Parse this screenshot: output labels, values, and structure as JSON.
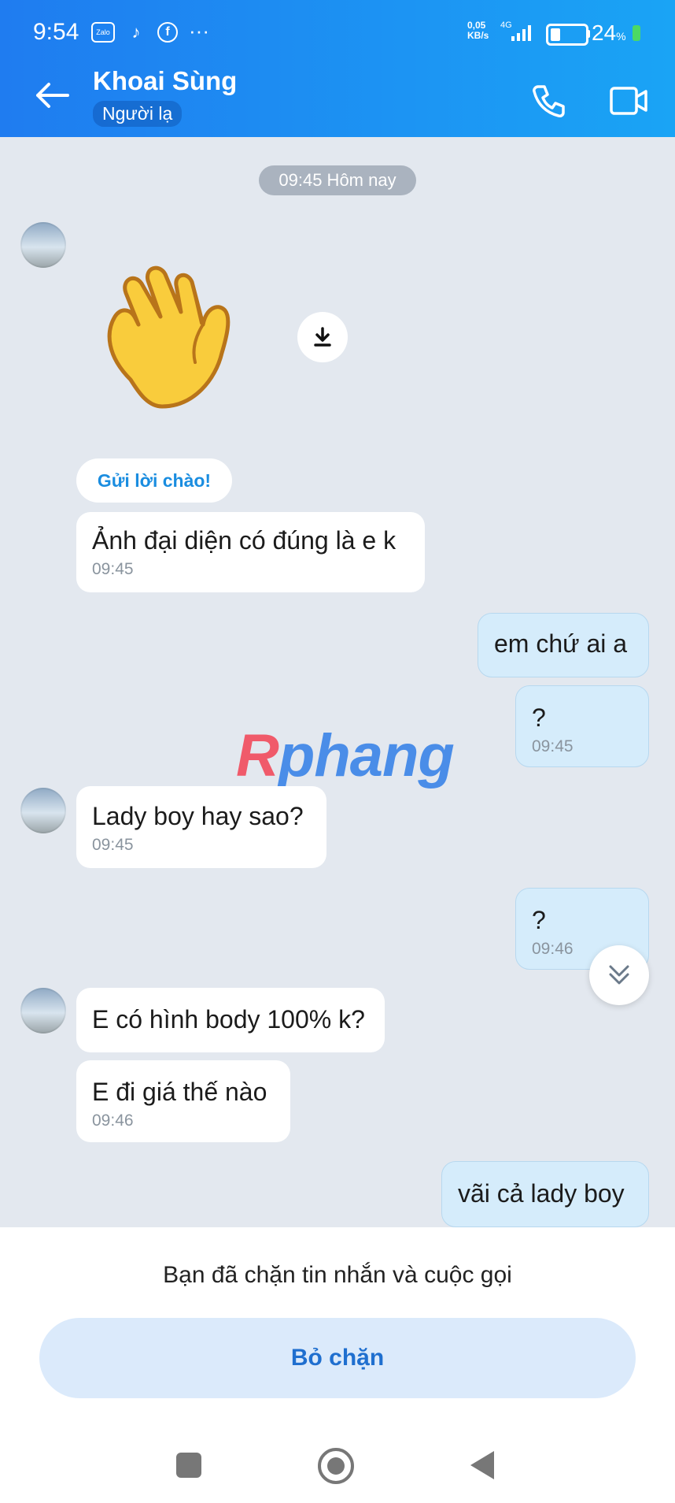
{
  "status_bar": {
    "time": "9:54",
    "net_speed_value": "0,05",
    "net_speed_unit": "KB/s",
    "network_type": "4G",
    "battery_percent": "24",
    "battery_unit": "%",
    "app_icons": [
      "zalo-icon",
      "tiktok-icon",
      "facebook-icon"
    ]
  },
  "header": {
    "contact_name": "Khoai Sùng",
    "contact_tag": "Người lạ"
  },
  "chat": {
    "date_pill": "09:45 Hôm nay",
    "greeting_chip": "Gửi lời chào!",
    "messages": [
      {
        "dir": "in",
        "text": "Ảnh đại diện có đúng là e k",
        "time": "09:45"
      },
      {
        "dir": "out",
        "text": "em chứ ai a",
        "time": ""
      },
      {
        "dir": "out",
        "text": "?",
        "time": "09:45"
      },
      {
        "dir": "in",
        "text": "Lady boy hay sao?",
        "time": "09:45"
      },
      {
        "dir": "out",
        "text": "?",
        "time": "09:46"
      },
      {
        "dir": "in",
        "text": "E có hình body 100% k?",
        "time": ""
      },
      {
        "dir": "in",
        "text": "E đi giá thế nào",
        "time": "09:46"
      },
      {
        "dir": "out",
        "text": "vãi cả lady boy",
        "time": ""
      }
    ]
  },
  "watermark": {
    "first": "R",
    "rest": "phang"
  },
  "bottom": {
    "blocked_notice": "Bạn đã chặn tin nhắn và cuộc gọi",
    "unblock_label": "Bỏ chặn"
  },
  "colors": {
    "header_start": "#1f7cf0",
    "header_end": "#1aa4f5",
    "accent": "#1f6fcf",
    "chat_bg": "#e3e8ef"
  }
}
